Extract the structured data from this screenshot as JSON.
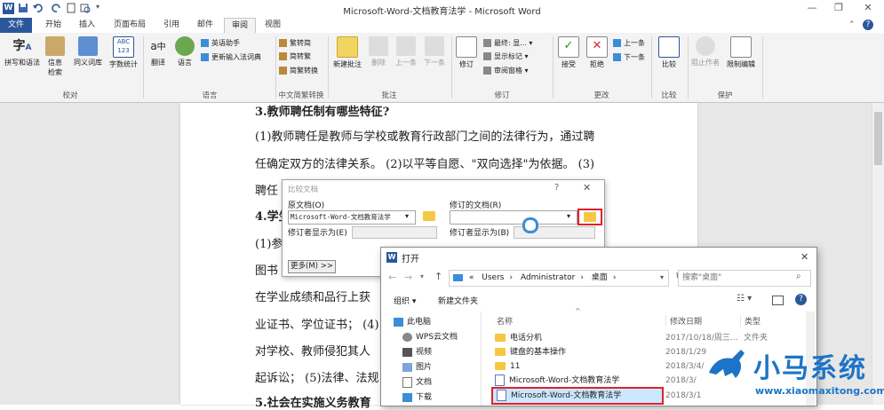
{
  "window": {
    "title": "Microsoft-Word-文档教育法学 - Microsoft Word",
    "app_icon": "W",
    "controls": {
      "minimize": "—",
      "restore": "❐",
      "close": "✕"
    }
  },
  "tabs": [
    "文件",
    "开始",
    "插入",
    "页面布局",
    "引用",
    "邮件",
    "审阅",
    "视图"
  ],
  "ribbon": {
    "groups": {
      "proof": "校对",
      "language": "语言",
      "chinese": "中文简繁转换",
      "comments": "批注",
      "tracking": "修订",
      "changes": "更改",
      "compare": "比较",
      "protect": "保护"
    },
    "buttons": {
      "spelling": "拼写和语法",
      "research": "信息检索",
      "thesaurus": "同义词库",
      "wordcount": "字数统计",
      "translate": "翻译",
      "language": "语言",
      "english_assist": "英语助手",
      "update_ime": "更新输入法词典",
      "trad_to_simp": "繁转简",
      "simp_to_trad": "简转繁",
      "convert": "简繁转换",
      "new_comment": "新建批注",
      "delete": "删除",
      "prev": "上一条",
      "next": "下一条",
      "track": "修订",
      "final_show": "最终: 显...",
      "show_markup": "显示标记",
      "review_pane": "审阅窗格",
      "accept": "接受",
      "reject": "拒绝",
      "prev_change": "上一条",
      "next_change": "下一条",
      "compare": "比较",
      "block_authors": "阻止作者",
      "restrict": "限制编辑"
    }
  },
  "document": {
    "lines": [
      "3.教师聘任制有哪些特征?",
      "(1)教师聘任是教师与学校或教育行政部门之间的法律行为，通过聘",
      "任确定双方的法律关系。 (2)以平等自愿、\"双向选择\"为依据。 (3)",
      "聘任",
      "4.学生",
      "(1)参",
      "图书",
      "在学业成绩和品行上获",
      "业证书、学位证书； (4)",
      "对学校、教师侵犯其人",
      "起诉讼； (5)法律、法规",
      "5.社会在实施义务教育"
    ]
  },
  "compare_dialog": {
    "title": "比较文档",
    "help": "?",
    "close": "✕",
    "original_label": "原文档(O)",
    "original_value": "Microsoft-Word-文档教育法学",
    "revised_label": "修订的文档(R)",
    "revised_value": "",
    "author_label_left": "修订者显示为(E)",
    "author_label_right": "修订者显示为(B)",
    "more_button": "更多(M) >>"
  },
  "open_dialog": {
    "title": "打开",
    "close": "✕",
    "path": [
      "Users",
      "Administrator",
      "桌面"
    ],
    "path_prefix": "«",
    "search_placeholder": "搜索\"桌面\"",
    "organize": "组织 ▾",
    "new_folder": "新建文件夹",
    "columns": {
      "name": "名称",
      "date": "修改日期",
      "type": "类型"
    },
    "nav": [
      "此电脑",
      "WPS云文档",
      "视频",
      "图片",
      "文档",
      "下载"
    ],
    "files": [
      {
        "name": "电话分机",
        "date": "2017/10/18/周三...",
        "type": "文件夹",
        "kind": "folder"
      },
      {
        "name": "键盘的基本操作",
        "date": "2018/1/29",
        "type": "",
        "kind": "folder"
      },
      {
        "name": "11",
        "date": "2018/3/4/",
        "type": "",
        "kind": "folder"
      },
      {
        "name": "Microsoft-Word-文档教育法学",
        "date": "2018/3/",
        "type": "",
        "kind": "doc"
      },
      {
        "name": "Microsoft-Word-文档教育法学",
        "date": "2018/3/1",
        "type": "",
        "kind": "doc"
      }
    ]
  },
  "watermark": {
    "brand": "小马系统",
    "url": "www.xiaomaxitong.com"
  },
  "colors": {
    "word_blue": "#2b579a",
    "highlight_red": "#e0212a",
    "selected_row": "#cce8ff",
    "watermark_blue": "#1d74c7"
  }
}
